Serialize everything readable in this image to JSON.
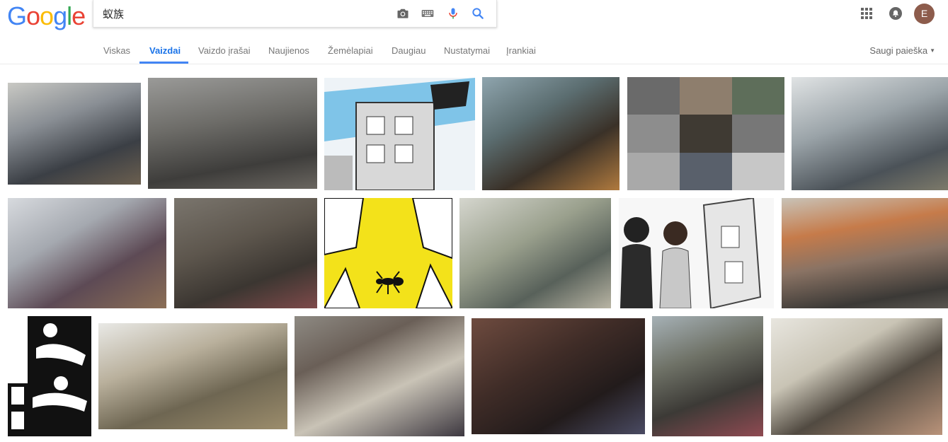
{
  "logo_text": "Google",
  "search": {
    "value": "蚁族"
  },
  "user": {
    "avatar_letter": "E"
  },
  "tabs": [
    {
      "label": "Viskas"
    },
    {
      "label": "Vaizdai"
    },
    {
      "label": "Vaizdo įrašai"
    },
    {
      "label": "Naujienos"
    },
    {
      "label": "Žemėlapiai"
    },
    {
      "label": "Daugiau"
    },
    {
      "label": "Nustatymai"
    },
    {
      "label": "Įrankiai"
    }
  ],
  "safe_search_label": "Saugi paieška",
  "icons": {
    "camera": "camera-icon",
    "keyboard": "keyboard-icon",
    "mic": "microphone-icon",
    "search": "search-icon",
    "apps": "apps-grid-icon",
    "notifications": "notifications-icon"
  },
  "colors": {
    "accent": "#4285f4",
    "mic_red": "#ea4335"
  },
  "results": [
    {
      "thumb": "photo: students in bunk-bed dorm at computers"
    },
    {
      "thumb": "photo: crowded basement with people lying on mats"
    },
    {
      "thumb": "cartoon: characters crowded in windows of tall building"
    },
    {
      "thumb": "photo: small dark room with bunk bed"
    },
    {
      "thumb": "photo collage: rooms and young people"
    },
    {
      "thumb": "photo: shirtless man on bunk bed in small room"
    },
    {
      "thumb": "photo: cluttered room with hanging clothes"
    },
    {
      "thumb": "photo: man sleeping amid bags in cramped room"
    },
    {
      "thumb": "illustration: ant among skyscrapers on yellow background"
    },
    {
      "thumb": "photo: man at laptop beside bed in small room"
    },
    {
      "thumb": "illustration: young couple looking at building"
    },
    {
      "thumb": "photo: people sitting outside shops on street"
    },
    {
      "thumb": "illustration: black and white figures with characters"
    },
    {
      "thumb": "photo: wide-angle view of bunk beds and people on floor"
    },
    {
      "thumb": "photo: women cooking on floor of small room"
    },
    {
      "thumb": "photo: shirtless man eating in dark room with tv"
    },
    {
      "thumb": "photo: man lying on bed with belongings"
    },
    {
      "thumb": "photo: man and woman at desks in small room"
    }
  ]
}
